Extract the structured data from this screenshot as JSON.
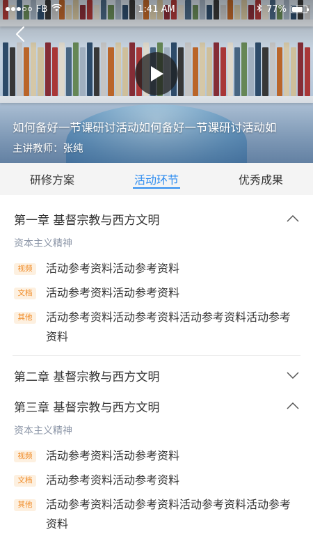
{
  "status_bar": {
    "carrier": "FB",
    "time": "1:41 AM",
    "battery": "77%",
    "battery_level": 0.77
  },
  "hero": {
    "title": "如何备好一节课研讨活动如何备好一节课研讨活动如",
    "teacher": "主讲教师：张纯"
  },
  "tabs": [
    {
      "label": "研修方案",
      "active": false
    },
    {
      "label": "活动环节",
      "active": true
    },
    {
      "label": "优秀成果",
      "active": false
    }
  ],
  "chapters": [
    {
      "title": "第一章 基督宗教与西方文明",
      "expanded": true,
      "section": "资本主义精神",
      "items": [
        {
          "tag": "视频",
          "text": "活动参考资料活动参考资料"
        },
        {
          "tag": "文档",
          "text": "活动参考资料活动参考资料"
        },
        {
          "tag": "其他",
          "text": "活动参考资料活动参考资料活动参考资料活动参考资料"
        }
      ]
    },
    {
      "title": "第二章 基督宗教与西方文明",
      "expanded": false
    },
    {
      "title": "第三章 基督宗教与西方文明",
      "expanded": true,
      "section": "资本主义精神",
      "items": [
        {
          "tag": "视频",
          "text": "活动参考资料活动参考资料"
        },
        {
          "tag": "文档",
          "text": "活动参考资料活动参考资料"
        },
        {
          "tag": "其他",
          "text": "活动参考资料活动参考资料活动参考资料活动参考资料"
        }
      ]
    }
  ],
  "icons": {
    "back": "chevron-left-icon",
    "play": "play-icon",
    "collapse": "chevron-up-icon",
    "expand": "chevron-down-icon"
  },
  "colors": {
    "accent": "#2d8cf0",
    "tag_text": "#f08a24",
    "tag_bg": "#fdf0e0",
    "section_label": "#8a94a6"
  }
}
